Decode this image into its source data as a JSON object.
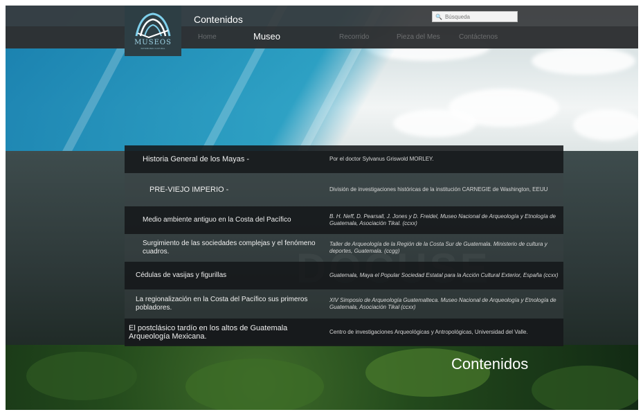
{
  "header": {
    "logo_text": "MUSEOS",
    "logo_subtext": "PATRIMONIO CULTURAL",
    "site_title": "Contenidos",
    "search": {
      "placeholder": "Búsqueda",
      "icon": "search-icon"
    },
    "nav": [
      {
        "label": "Home",
        "active": false
      },
      {
        "label": "Museo",
        "active": true
      },
      {
        "label": "Recorrido",
        "active": false
      },
      {
        "label": "Pieza del Mes",
        "active": false
      },
      {
        "label": "Contáctenos",
        "active": false
      }
    ]
  },
  "contents": [
    {
      "title": "Historia General de los Mayas -",
      "source": "Por el doctor Sylvanus Griswold MORLEY."
    },
    {
      "title": "PRE-VIEJO IMPERIO -",
      "source": "División de investigaciones históricas de la institución CARNEGIE de Washington, EEUU"
    },
    {
      "title": "Medio ambiente antiguo en la Costa del Pacífico",
      "source": "B. H. Neff, D. Pearsall, J. Jones y D. Freidel, Museo Nacional de Arqueología y Etnología de Guatemala, Asociación Tikal. (ccxx)"
    },
    {
      "title": "Surgimiento de las sociedades complejas y el fenómeno cuadros.",
      "source": "Taller de Arqueología de la Región de la Costa Sur de Guatemala. Ministerio de cultura y deportes, Guatemala. (ccgg)"
    },
    {
      "title": "Cédulas de vasijas y figurillas",
      "source": "Guatemala, Maya el Popular Sociedad Estatal para la Acción Cultural Exterior, España (ccxx)"
    },
    {
      "title": "La regionalización en la Costa del Pacífico sus primeros pobladores.",
      "source": "XIV Simposio de Arqueología Guatemalteca. Museo Nacional de Arqueología y Etnología de Guatemala, Asociación Tikal (ccxx)"
    },
    {
      "title": "El postclásico tardío en los altos de Guatemala Arqueología Mexicana.",
      "source": "Centro de investigaciones Arqueológicas y Antropológicas, Universidad del Valle."
    }
  ],
  "footer": {
    "title": "Contenidos"
  }
}
